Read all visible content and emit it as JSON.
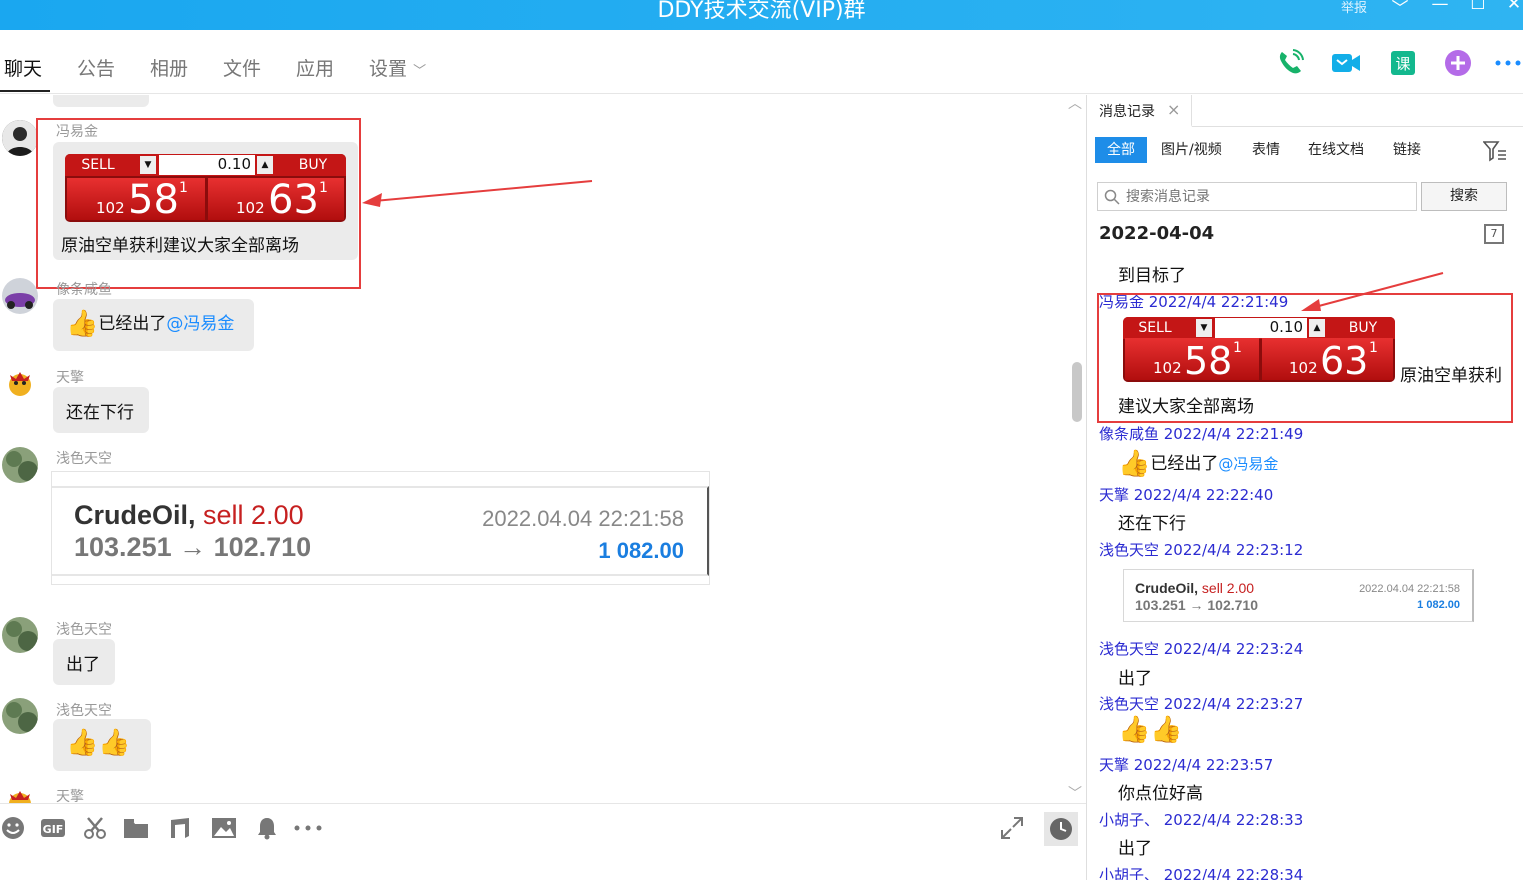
{
  "window": {
    "title": "DDY技术交流(VIP)群",
    "report_label": "举报",
    "minimize_glyph": "—",
    "restore_glyph": "☐",
    "close_glyph": "✕",
    "dropdown_glyph": "﹀"
  },
  "tabs": [
    {
      "label": "聊天",
      "active": true
    },
    {
      "label": "公告"
    },
    {
      "label": "相册"
    },
    {
      "label": "文件"
    },
    {
      "label": "应用"
    },
    {
      "label": "设置"
    }
  ],
  "tab_settings_chevron": "﹀",
  "header_icons": [
    "phone-icon",
    "video-icon",
    "course-icon",
    "add-app-icon",
    "more-icon"
  ],
  "chat": {
    "messages": [
      {
        "sender": "冯易金",
        "ticket": {
          "sell": "SELL",
          "buy": "BUY",
          "quantity": "0.10",
          "bid_prefix": "102",
          "bid_main": "58",
          "bid_sup": "1",
          "ask_prefix": "102",
          "ask_main": "63",
          "ask_sup": "1"
        },
        "text": "原油空单获利建议大家全部离场"
      },
      {
        "sender": "像条咸鱼",
        "text": "已经出了",
        "mention": "@冯易金"
      },
      {
        "sender": "天擎",
        "text": "还在下行"
      },
      {
        "sender": "浅色天空",
        "card": {
          "symbol": "CrudeOil,",
          "side": "sell 2.00",
          "prices": "103.251 → 102.710",
          "datetime": "2022.04.04 22:21:58",
          "profit": "1 082.00"
        }
      },
      {
        "sender": "浅色天空",
        "text": "出了"
      },
      {
        "sender": "浅色天空",
        "thumbs": 2
      },
      {
        "sender": "天擎"
      }
    ],
    "scroll_top_glyph": "︿",
    "scroll_bottom_glyph": "﹀"
  },
  "toolbar_icons": [
    "emoji-icon",
    "gif-icon",
    "scissors-icon",
    "folder-icon",
    "music-icon",
    "image-icon",
    "bell-icon",
    "more-icon"
  ],
  "toolbar_right_icons": [
    "expand-icon",
    "history-icon"
  ],
  "history": {
    "tab_label": "消息记录",
    "tab_close": "×",
    "filters": [
      "全部",
      "图片/视频",
      "表情",
      "在线文档",
      "链接"
    ],
    "search_placeholder": "搜索消息记录",
    "search_button": "搜索",
    "date": "2022-04-04",
    "calendar_day": "7",
    "records": [
      {
        "text": "到目标了"
      },
      {
        "meta": "冯易金 2022/4/4 22:21:49",
        "ticket": {
          "sell": "SELL",
          "buy": "BUY",
          "quantity": "0.10",
          "bid_prefix": "102",
          "bid_main": "58",
          "bid_sup": "1",
          "ask_prefix": "102",
          "ask_main": "63",
          "ask_sup": "1"
        },
        "text_inline": "原油空单获利",
        "text": "建议大家全部离场"
      },
      {
        "meta": "像条咸鱼 2022/4/4 22:21:49",
        "text": "已经出了",
        "mention": "@冯易金"
      },
      {
        "meta": "天擎 2022/4/4 22:22:40",
        "text": "还在下行"
      },
      {
        "meta": "浅色天空 2022/4/4 22:23:12",
        "card": {
          "symbol": "CrudeOil,",
          "side": "sell 2.00",
          "prices": "103.251 → 102.710",
          "datetime": "2022.04.04 22:21:58",
          "profit": "1 082.00"
        }
      },
      {
        "meta": "浅色天空 2022/4/4 22:23:24",
        "text": "出了"
      },
      {
        "meta": "浅色天空 2022/4/4 22:23:27",
        "thumbs": 2
      },
      {
        "meta": "天擎 2022/4/4 22:23:57",
        "text": "你点位好高"
      },
      {
        "meta": "小胡子、 2022/4/4 22:28:33",
        "text": "出了"
      },
      {
        "meta": "小胡子、 2022/4/4 22:28:34"
      }
    ]
  },
  "colors": {
    "titlebar": "#1aa7f0",
    "highlight_box": "#e53d3d",
    "mention": "#1a8cff",
    "history_meta": "#2b2bd1",
    "active_filter": "#1e8de8",
    "ticket_red": "#c41616"
  }
}
